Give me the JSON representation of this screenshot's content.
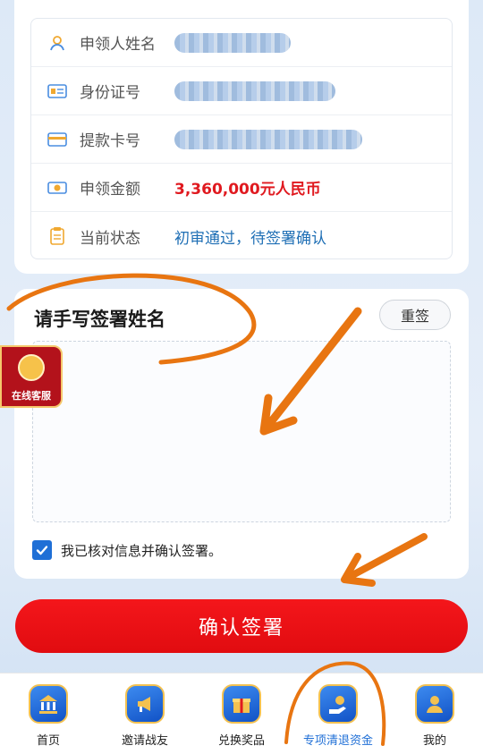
{
  "info": {
    "rows": [
      {
        "icon": "person-icon",
        "label": "申领人姓名",
        "value": ""
      },
      {
        "icon": "id-card-icon",
        "label": "身份证号",
        "value": ""
      },
      {
        "icon": "bank-card-icon",
        "label": "提款卡号",
        "value": ""
      },
      {
        "icon": "money-icon",
        "label": "申领金额",
        "value": "3,360,000元人民币"
      },
      {
        "icon": "clipboard-icon",
        "label": "当前状态",
        "value": "初审通过，待签署确认"
      }
    ]
  },
  "sign": {
    "title": "请手写签署姓名",
    "reset_label": "重签",
    "confirm_text": "我已核对信息并确认签署。",
    "checked": true
  },
  "service": {
    "label": "在线客服"
  },
  "submit": {
    "label": "确认签署"
  },
  "tabbar": {
    "items": [
      {
        "label": "首页",
        "icon": "bank-icon"
      },
      {
        "label": "邀请战友",
        "icon": "megaphone-icon"
      },
      {
        "label": "兑换奖品",
        "icon": "gift-icon"
      },
      {
        "label": "专项清退资金",
        "icon": "money-hand-icon",
        "active": true
      },
      {
        "label": "我的",
        "icon": "user-icon"
      }
    ]
  },
  "colors": {
    "accent_red": "#e0191f",
    "accent_blue": "#1f6fb5",
    "annotation_orange": "#e87511"
  }
}
